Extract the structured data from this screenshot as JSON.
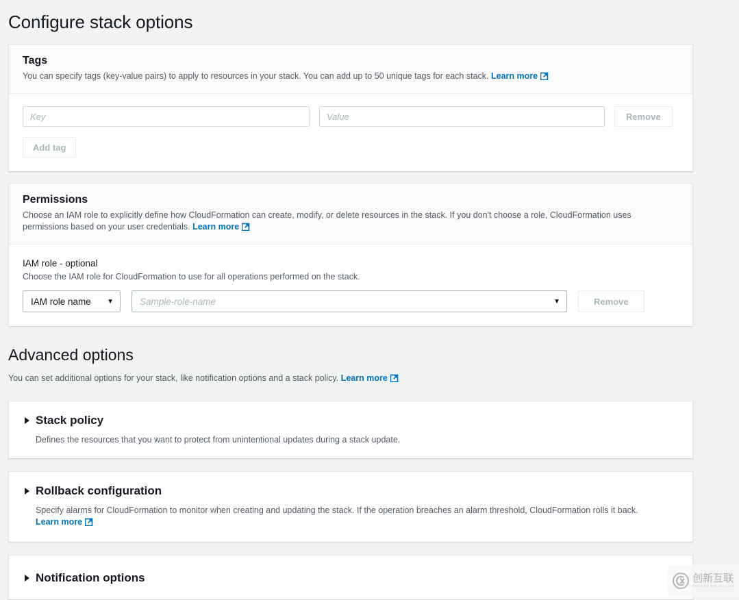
{
  "page": {
    "title": "Configure stack options"
  },
  "tags": {
    "title": "Tags",
    "description": "You can specify tags (key-value pairs) to apply to resources in your stack. You can add up to 50 unique tags for each stack.",
    "learn_more": "Learn more",
    "key_placeholder": "Key",
    "key_value": "",
    "value_placeholder": "Value",
    "value_value": "",
    "remove_label": "Remove",
    "add_tag_label": "Add tag"
  },
  "permissions": {
    "title": "Permissions",
    "description": "Choose an IAM role to explicitly define how CloudFormation can create, modify, or delete resources in the stack. If you don't choose a role, CloudFormation uses permissions based on your user credentials.",
    "learn_more": "Learn more",
    "iam_role": {
      "label": "IAM role - optional",
      "description": "Choose the IAM role for CloudFormation to use for all operations performed on the stack.",
      "role_type_selected": "IAM role name",
      "role_name_placeholder": "Sample-role-name",
      "remove_label": "Remove"
    }
  },
  "advanced": {
    "title": "Advanced options",
    "description": "You can set additional options for your stack, like notification options and a stack policy.",
    "learn_more": "Learn more",
    "sections": [
      {
        "title": "Stack policy",
        "description": "Defines the resources that you want to protect from unintentional updates during a stack update.",
        "expanded": false
      },
      {
        "title": "Rollback configuration",
        "description": "Specify alarms for CloudFormation to monitor when creating and updating the stack. If the operation breaches an alarm threshold, CloudFormation rolls it back.",
        "learn_more": "Learn more",
        "expanded": false
      },
      {
        "title": "Notification options",
        "description": "",
        "expanded": false
      }
    ]
  },
  "watermark": {
    "cn_text": "创新互联",
    "en_text": "CHUANG XIN HU LIAN"
  },
  "colors": {
    "link": "#0073bb",
    "page_bg": "#f2f3f3",
    "card_bg": "#ffffff",
    "card_header_bg": "#fafafa",
    "text_primary": "#16191f",
    "text_secondary": "#545b64",
    "disabled": "#aab7b8"
  }
}
